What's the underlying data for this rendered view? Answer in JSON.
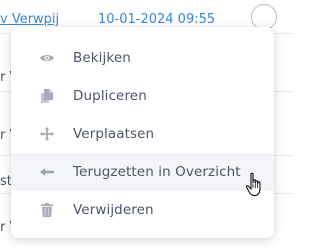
{
  "list": {
    "row1": {
      "link_text": "v Verwpij",
      "date_text": "10-01-2024 09:55"
    },
    "partial_rows": [
      "r V",
      "r V",
      "r V",
      "st",
      "r V"
    ]
  },
  "menu": {
    "items": [
      {
        "label": "Bekijken",
        "icon": "eye-icon"
      },
      {
        "label": "Dupliceren",
        "icon": "copy-icon"
      },
      {
        "label": "Verplaatsen",
        "icon": "move-icon"
      },
      {
        "label": "Terugzetten in Overzicht",
        "icon": "arrow-left-icon"
      },
      {
        "label": "Verwijderen",
        "icon": "trash-icon"
      }
    ]
  },
  "colors": {
    "link": "#3a86d8",
    "menu_text": "#4c5566",
    "icon": "#a7adb6",
    "hover_bg": "#f3f5f8"
  }
}
